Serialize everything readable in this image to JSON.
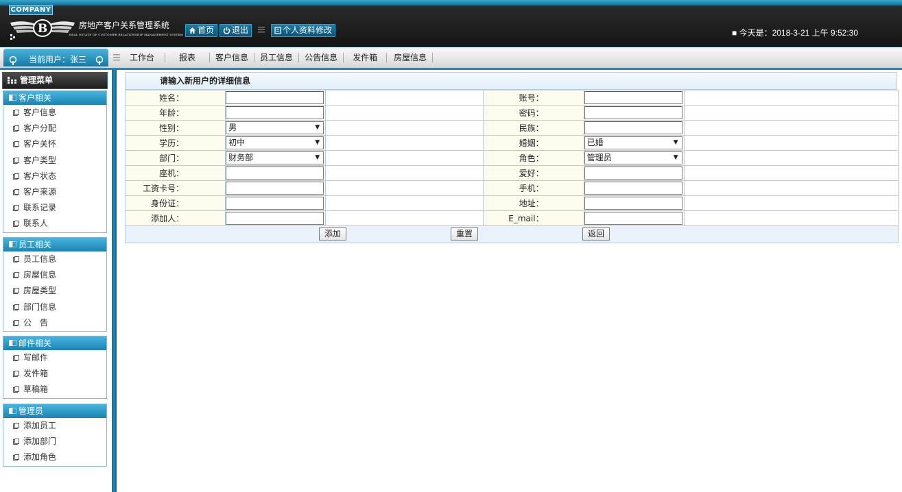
{
  "header": {
    "company": "COMPANY",
    "system_title": "房地产客户关系管理系统",
    "system_subtitle": "REAL ESTATE OF CUSTOMER RELATIONSHIP MANAGEMENT SYSTEM",
    "home_label": "首页",
    "exit_label": "退出",
    "profile_label": "个人资料修改",
    "datetime": "■ 今天是：2018-3-21 上午 9:52:30"
  },
  "nav": {
    "current_user": "当前用户：张三",
    "links": [
      "工作台",
      "报表",
      "客户信息",
      "员工信息",
      "公告信息",
      "发件箱",
      "房屋信息"
    ]
  },
  "sidebar": {
    "title": "管理菜单",
    "groups": [
      {
        "title": "客户相关",
        "items": [
          "客户信息",
          "客户分配",
          "客户关怀",
          "客户类型",
          "客户状态",
          "客户来源",
          "联系记录",
          "联系人"
        ]
      },
      {
        "title": "员工相关",
        "items": [
          "员工信息",
          "房屋信息",
          "房屋类型",
          "部门信息",
          "公　告"
        ]
      },
      {
        "title": "邮件相关",
        "items": [
          "写邮件",
          "发件箱",
          "草稿箱"
        ]
      },
      {
        "title": "管理员",
        "items": [
          "添加员工",
          "添加部门",
          "添加角色"
        ]
      }
    ]
  },
  "form": {
    "title": "请输入新用户的详细信息",
    "left_labels": [
      "姓名：",
      "年龄：",
      "性别：",
      "学历：",
      "部门：",
      "座机：",
      "工资卡号：",
      "身份证：",
      "添加人："
    ],
    "right_labels": [
      "账号：",
      "密码：",
      "民族：",
      "婚姻：",
      "角色：",
      "爱好：",
      "手机：",
      "地址：",
      "E_mail："
    ],
    "gender_value": "男",
    "education_value": "初中",
    "department_value": "财务部",
    "marriage_value": "已婚",
    "role_value": "管理员",
    "add_button": "添加",
    "reset_button": "重置",
    "back_button": "返回"
  },
  "colors": {
    "accent": "#1b8cbb",
    "header_dark": "#1f1f1f",
    "label_cell_bg": "#fefcef",
    "border": "#b5cfe2"
  },
  "icons": {
    "logo": "winged-b-logo",
    "home": "home-icon",
    "exit": "power-icon",
    "profile": "document-icon",
    "menu": "grid-icon",
    "group": "book-icon",
    "item": "page-icon"
  }
}
